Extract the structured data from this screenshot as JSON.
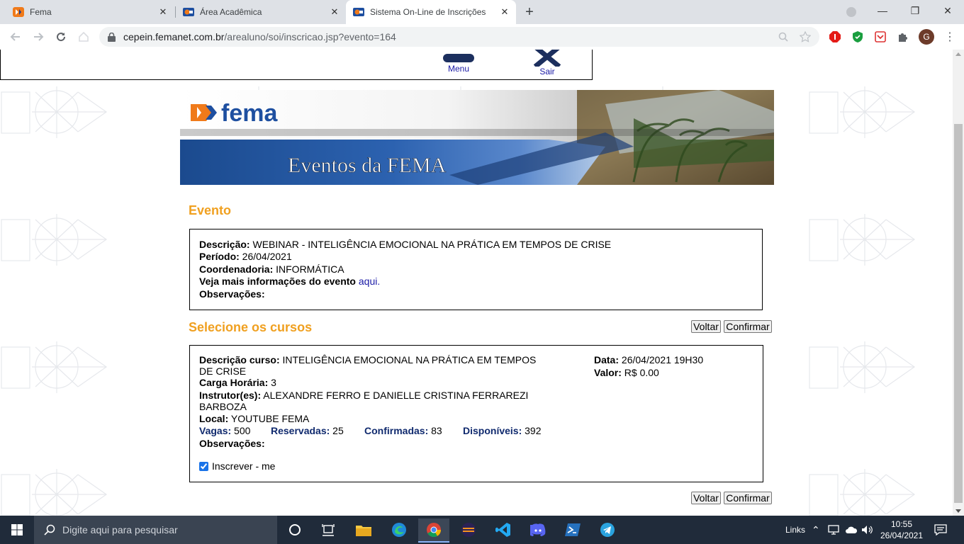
{
  "browser": {
    "tabs": [
      {
        "title": "Fema",
        "active": false
      },
      {
        "title": "Área Acadêmica",
        "active": false
      },
      {
        "title": "Sistema On-Line de Inscrições",
        "active": true
      }
    ],
    "url_host": "cepein.femanet.com.br",
    "url_path": "/arealuno/soi/inscricao.jsp?evento=164",
    "profile_initial": "G"
  },
  "topmenu": {
    "menu_label": "Menu",
    "exit_label": "Sair"
  },
  "banner": {
    "logo_text": "fema",
    "title": "Eventos da FEMA"
  },
  "evento": {
    "heading": "Evento",
    "descricao_label": "Descrição:",
    "descricao_value": "WEBINAR - INTELIGÊNCIA EMOCIONAL NA PRÁTICA EM TEMPOS DE CRISE",
    "periodo_label": "Período:",
    "periodo_value": "26/04/2021",
    "coordenadoria_label": "Coordenadoria:",
    "coordenadoria_value": "INFORMÁTICA",
    "mais_info_label": "Veja mais informações do evento",
    "mais_info_link": "aqui.",
    "observacoes_label": "Observações:"
  },
  "cursos": {
    "heading": "Selecione os cursos",
    "voltar_label": "Voltar",
    "confirmar_label": "Confirmar",
    "descricao_label": "Descrição curso:",
    "descricao_value_1": "INTELIGÊNCIA EMOCIONAL NA PRÁTICA EM TEMPOS",
    "descricao_value_2": "DE CRISE",
    "carga_label": "Carga Horária:",
    "carga_value": "3",
    "instrutor_label": "Instrutor(es):",
    "instrutor_value_1": "ALEXANDRE FERRO E DANIELLE CRISTINA FERRAREZI",
    "instrutor_value_2": "BARBOZA",
    "local_label": "Local:",
    "local_value": "YOUTUBE FEMA",
    "vagas_label": "Vagas:",
    "vagas_value": "500",
    "reservadas_label": "Reservadas:",
    "reservadas_value": "25",
    "confirmadas_label": "Confirmadas:",
    "confirmadas_value": "83",
    "disponiveis_label": "Disponíveis:",
    "disponiveis_value": "392",
    "observacoes_label": "Observações:",
    "data_label": "Data:",
    "data_value": "26/04/2021 19H30",
    "valor_label": "Valor:",
    "valor_value": "R$ 0.00",
    "inscrever_label": "Inscrever - me",
    "inscrever_checked": true
  },
  "taskbar": {
    "search_placeholder": "Digite aqui para pesquisar",
    "links_label": "Links",
    "time": "10:55",
    "date": "26/04/2021"
  },
  "colors": {
    "accent_orange": "#f0a020",
    "link_blue": "#1a1aa6",
    "navy": "#102a6e"
  }
}
